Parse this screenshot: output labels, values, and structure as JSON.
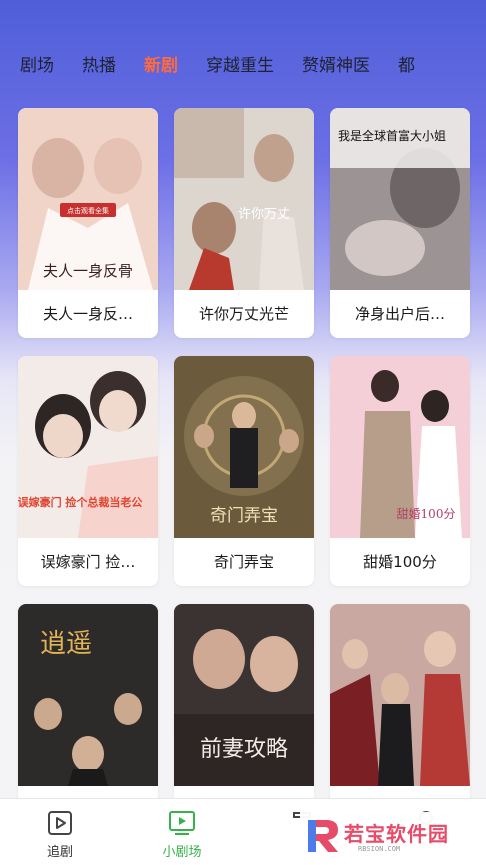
{
  "tabs": [
    {
      "label": "剧场",
      "active": false
    },
    {
      "label": "热播",
      "active": false
    },
    {
      "label": "新剧",
      "active": true
    },
    {
      "label": "穿越重生",
      "active": false
    },
    {
      "label": "赘婿神医",
      "active": false
    },
    {
      "label": "都",
      "active": false
    }
  ],
  "cards": [
    {
      "title": "夫人一身反…",
      "poster_text": "夫人一身反骨",
      "badge": "点击观看全集",
      "poster_color": "#f1d4c8"
    },
    {
      "title": "许你万丈光芒",
      "poster_text": "许你万丈",
      "poster_color": "#dcd6cf"
    },
    {
      "title": "净身出户后…",
      "poster_text": "我是全球首富大小姐",
      "poster_color": "#9b9394"
    },
    {
      "title": "误嫁豪门 捡…",
      "poster_text": "误嫁豪门 捡个总裁当老公",
      "poster_color": "#f3ebe8"
    },
    {
      "title": "奇门弄宝",
      "poster_text": "奇门弄宝",
      "poster_color": "#6b5a3c"
    },
    {
      "title": "甜婚100分",
      "poster_text": "甜婚100分",
      "poster_color": "#f4cfd7"
    },
    {
      "title": "",
      "poster_text": "逍遥",
      "poster_color": "#2d2a2a"
    },
    {
      "title": "",
      "poster_text": "前妻攻略",
      "poster_color": "#3b3331"
    },
    {
      "title": "",
      "poster_text": "",
      "poster_color": "#c8a8a0"
    }
  ],
  "bottom_nav": [
    {
      "label": "追剧",
      "icon": "play-box-icon",
      "active": false
    },
    {
      "label": "小剧场",
      "icon": "tv-play-icon",
      "active": true
    }
  ],
  "watermark": {
    "name": "若宝软件园",
    "url": "RBSION.COM"
  }
}
